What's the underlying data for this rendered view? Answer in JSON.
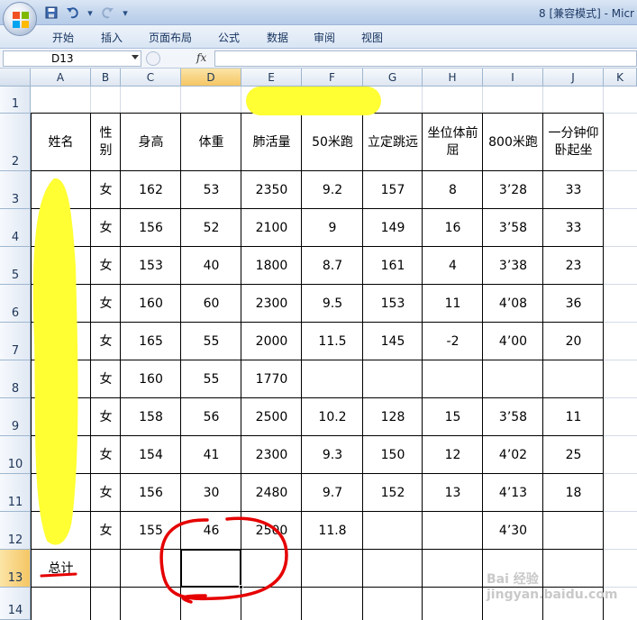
{
  "window": {
    "title": "8  [兼容模式] - Micr"
  },
  "ribbon": {
    "tabs": [
      "开始",
      "插入",
      "页面布局",
      "公式",
      "数据",
      "审阅",
      "视图"
    ]
  },
  "formula_bar": {
    "name_box": "D13",
    "fx_label": "fx",
    "formula": ""
  },
  "columns": [
    "A",
    "B",
    "C",
    "D",
    "E",
    "F",
    "G",
    "H",
    "I",
    "J",
    "K"
  ],
  "rows": [
    "1",
    "2",
    "3",
    "4",
    "5",
    "6",
    "7",
    "8",
    "9",
    "10",
    "11",
    "12",
    "13",
    "14"
  ],
  "active_cell": "D13",
  "table": {
    "headers": [
      "姓名",
      "性别",
      "身高",
      "体重",
      "肺活量",
      "50米跑",
      "立定跳远",
      "坐位体前屈",
      "800米跑",
      "一分钟仰卧起坐"
    ],
    "rows": [
      [
        "",
        "女",
        "162",
        "53",
        "2350",
        "9.2",
        "157",
        "8",
        "3’28",
        "33"
      ],
      [
        "",
        "女",
        "156",
        "52",
        "2100",
        "9",
        "149",
        "16",
        "3’58",
        "33"
      ],
      [
        "",
        "女",
        "153",
        "40",
        "1800",
        "8.7",
        "161",
        "4",
        "3’38",
        "23"
      ],
      [
        "",
        "女",
        "160",
        "60",
        "2300",
        "9.5",
        "153",
        "11",
        "4’08",
        "36"
      ],
      [
        "",
        "女",
        "165",
        "55",
        "2000",
        "11.5",
        "145",
        "-2",
        "4’00",
        "20"
      ],
      [
        "",
        "女",
        "160",
        "55",
        "1770",
        "",
        "",
        "",
        "",
        ""
      ],
      [
        "",
        "女",
        "158",
        "56",
        "2500",
        "10.2",
        "128",
        "15",
        "3’58",
        "11"
      ],
      [
        "",
        "女",
        "154",
        "41",
        "2300",
        "9.3",
        "150",
        "12",
        "4’02",
        "25"
      ],
      [
        "",
        "女",
        "156",
        "30",
        "2480",
        "9.7",
        "152",
        "13",
        "4’13",
        "18"
      ],
      [
        "",
        "女",
        "155",
        "46",
        "2500",
        "11.8",
        "",
        "",
        "4’30",
        ""
      ]
    ],
    "total_label": "总计"
  },
  "colors": {
    "highlighter": "#ffff33",
    "annotation": "#e60000"
  },
  "watermark": "Bai 经验  jingyan.baidu.com"
}
